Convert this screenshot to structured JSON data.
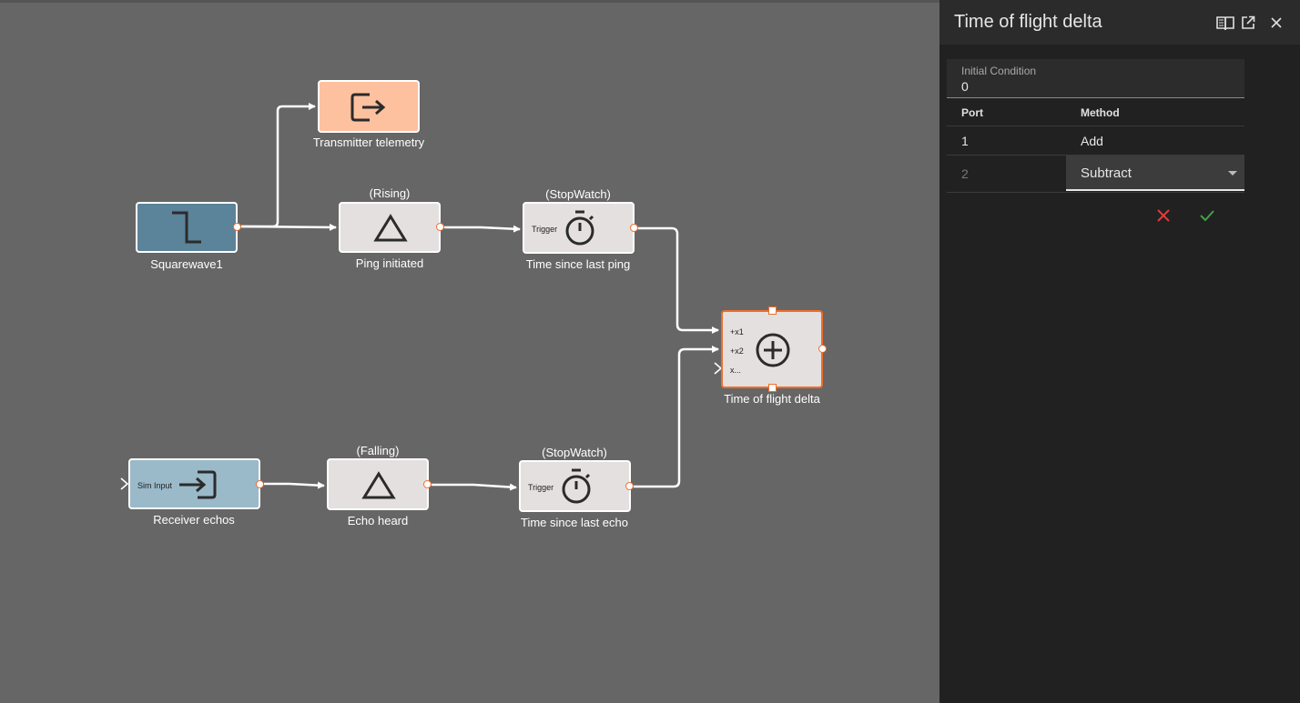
{
  "diagram": {
    "blocks": {
      "squarewave": {
        "label": "Squarewave1"
      },
      "transmitter": {
        "label": "Transmitter telemetry"
      },
      "ping": {
        "label": "Ping initiated",
        "annotation": "(Rising)"
      },
      "stopwatch_ping": {
        "label": "Time since last ping",
        "annotation": "(StopWatch)",
        "port_label": "Trigger"
      },
      "sum": {
        "label": "Time of flight delta",
        "port_labels": [
          "+x1",
          "+x2",
          "x..."
        ]
      },
      "receiver": {
        "label": "Receiver echos",
        "port_label": "Sim Input"
      },
      "echo": {
        "label": "Echo heard",
        "annotation": "(Falling)"
      },
      "stopwatch_echo": {
        "label": "Time since last echo",
        "annotation": "(StopWatch)",
        "port_label": "Trigger"
      }
    },
    "colors": {
      "canvas": "#666666",
      "block": "#e4e0df",
      "squarewave": "#5b8399",
      "receiver": "#9ab9c9",
      "transmitter": "#fdc19f",
      "selected_border": "#f06d2a",
      "wire": "#ffffff"
    }
  },
  "panel": {
    "title": "Time of flight delta",
    "icons": [
      "book-icon",
      "open-external-icon",
      "close-icon"
    ],
    "initial_condition": {
      "label": "Initial Condition",
      "value": "0"
    },
    "table": {
      "headers": {
        "port": "Port",
        "method": "Method"
      },
      "rows": [
        {
          "port": "1",
          "method": "Add"
        },
        {
          "port": "2",
          "method": "Subtract"
        }
      ]
    },
    "colors": {
      "cancel": "#e53935",
      "confirm": "#43a047"
    }
  }
}
